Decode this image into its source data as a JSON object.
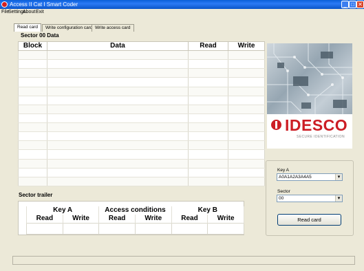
{
  "window": {
    "title": "Access II Cat I Smart Coder",
    "controls": {
      "minimize": "_",
      "maximize": "□",
      "close": "✕"
    }
  },
  "menu": [
    "File",
    "Settings",
    "About",
    "Exit"
  ],
  "tabs": [
    {
      "label": "Read card",
      "active": true
    },
    {
      "label": "Write configuration card",
      "active": false
    },
    {
      "label": "Write access card",
      "active": false
    }
  ],
  "sector_data": {
    "label": "Sector 00 Data",
    "columns": [
      "Block",
      "Data",
      "Read",
      "Write"
    ],
    "row_count": 15
  },
  "sector_trailer": {
    "label": "Sector trailer",
    "group_headers": [
      "Key A",
      "Access conditions",
      "Key B"
    ],
    "sub_headers": [
      "Read",
      "Write",
      "Read",
      "Write",
      "Read",
      "Write"
    ]
  },
  "logo": {
    "brand": "IDESCO",
    "tagline": "SECURE IDENTIFICATION",
    "brand_color": "#cc1d24"
  },
  "key_a": {
    "label": "Key A",
    "value": "A0A1A2A3A4A5"
  },
  "sector": {
    "label": "Sector",
    "value": "00"
  },
  "read_button": "Read card",
  "status": ""
}
